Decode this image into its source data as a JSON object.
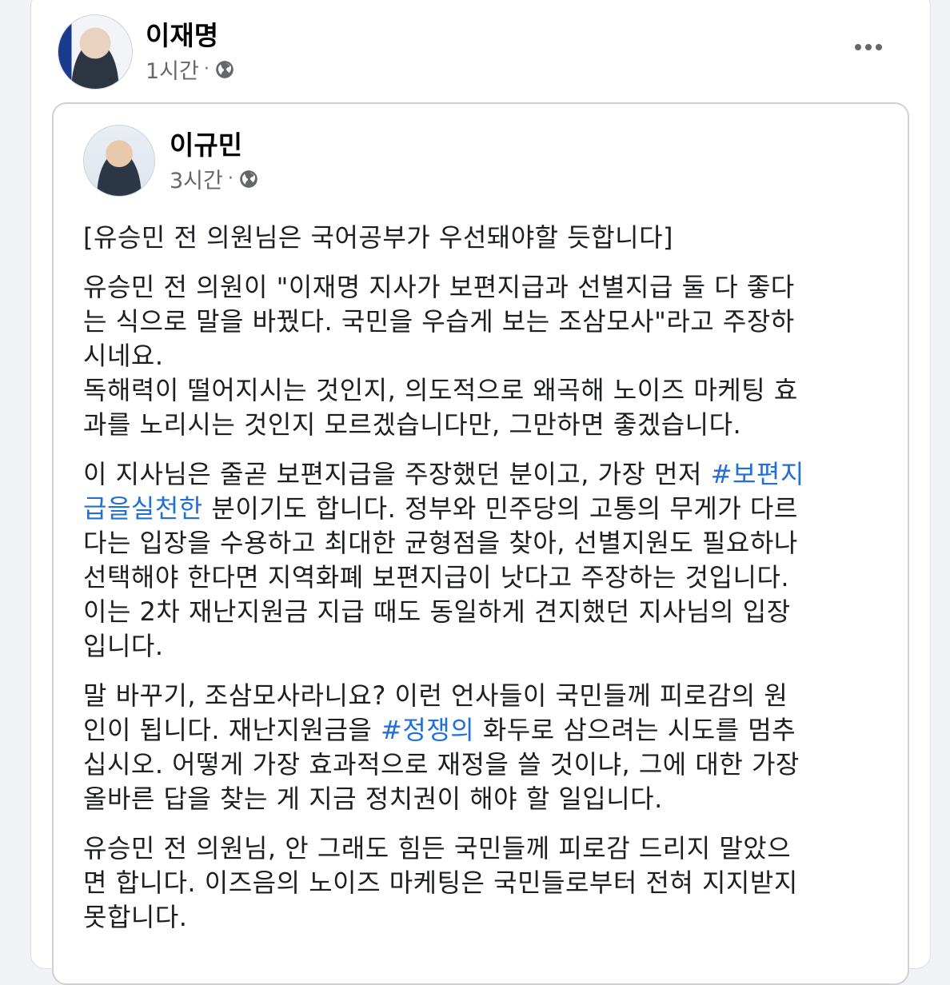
{
  "post": {
    "author": "이재명",
    "time": "1시간",
    "privacy_icon": "globe-icon",
    "more_icon": "more-icon"
  },
  "shared_post": {
    "author": "이규민",
    "time": "3시간",
    "privacy_icon": "globe-icon",
    "paragraphs": [
      {
        "text": "[유승민 전 의원님은 국어공부가 우선돼야할 듯합니다]"
      },
      {
        "text": "유승민 전 의원이 \"이재명 지사가 보편지급과 선별지급 둘 다 좋다\n는 식으로 말을 바꿨다. 국민을 우습게 보는 조삼모사\"라고 주장하\n시네요.\n독해력이 떨어지시는 것인지, 의도적으로 왜곡해 노이즈 마케팅 효\n과를 노리시는 것인지 모르겠습니다만, 그만하면 좋겠습니다."
      },
      {
        "before": "이 지사님은 줄곧 보편지급을 주장했던 분이고, 가장 먼저 ",
        "tag": "#보편지\n급을실천한",
        "after": " 분이기도 합니다. 정부와 민주당의 고통의 무게가 다르\n다는 입장을 수용하고 최대한 균형점을 찾아, 선별지원도 필요하나\n선택해야 한다면 지역화폐 보편지급이 낫다고 주장하는 것입니다.\n이는 2차 재난지원금 지급 때도 동일하게 견지했던 지사님의 입장\n입니다."
      },
      {
        "before": "말 바꾸기, 조삼모사라니요? 이런 언사들이 국민들께 피로감의 원\n인이 됩니다. 재난지원금을 ",
        "tag": "#정쟁의",
        "after": " 화두로 삼으려는 시도를 멈추\n십시오. 어떻게 가장 효과적으로 재정을 쓸 것이냐, 그에 대한 가장\n올바른 답을 찾는 게 지금 정치권이 해야 할 일입니다."
      },
      {
        "text": "유승민 전 의원님, 안 그래도 힘든 국민들께 피로감 드리지 말았으\n면 합니다. 이즈음의 노이즈 마케팅은 국민들로부터 전혀 지지받지\n못합니다."
      }
    ]
  },
  "colors": {
    "hashtag": "#216fdb",
    "meta_text": "#65676b",
    "background": "#f0f2f5"
  }
}
